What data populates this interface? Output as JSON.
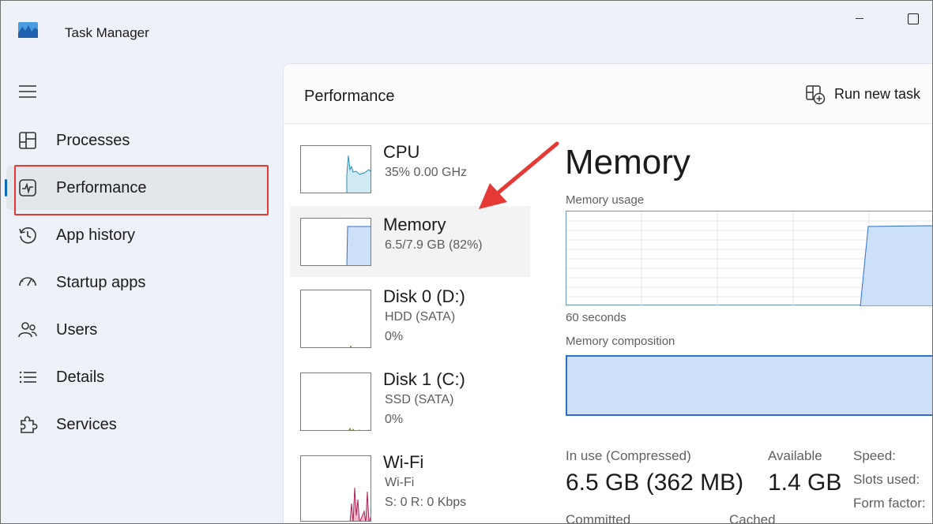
{
  "window": {
    "title": "Task Manager"
  },
  "sidebar": {
    "items": [
      {
        "label": "Processes",
        "icon": "processes-icon",
        "active": false
      },
      {
        "label": "Performance",
        "icon": "performance-icon",
        "active": true
      },
      {
        "label": "App history",
        "icon": "history-icon",
        "active": false
      },
      {
        "label": "Startup apps",
        "icon": "speedometer-icon",
        "active": false
      },
      {
        "label": "Users",
        "icon": "users-icon",
        "active": false
      },
      {
        "label": "Details",
        "icon": "list-icon",
        "active": false
      },
      {
        "label": "Services",
        "icon": "puzzle-icon",
        "active": false
      }
    ]
  },
  "header": {
    "title": "Performance",
    "run_task_label": "Run new task"
  },
  "devices": [
    {
      "name": "CPU",
      "sub1": "35%  0.00 GHz",
      "sub2": ""
    },
    {
      "name": "Memory",
      "sub1": "6.5/7.9 GB (82%)",
      "sub2": ""
    },
    {
      "name": "Disk 0 (D:)",
      "sub1": "HDD (SATA)",
      "sub2": "0%"
    },
    {
      "name": "Disk 1 (C:)",
      "sub1": "SSD (SATA)",
      "sub2": "0%"
    },
    {
      "name": "Wi-Fi",
      "sub1": "Wi-Fi",
      "sub2": "S: 0  R: 0 Kbps"
    }
  ],
  "detail": {
    "title": "Memory",
    "usage_label": "Memory usage",
    "time_label": "60 seconds",
    "composition_label": "Memory composition",
    "in_use_label": "In use (Compressed)",
    "in_use_value": "6.5 GB (362 MB)",
    "available_label": "Available",
    "available_value": "1.4 GB",
    "committed_label": "Committed",
    "cached_label": "Cached",
    "specs": [
      "Speed:",
      "Slots used:",
      "Form factor:"
    ]
  },
  "colors": {
    "accent": "#0f6cbd",
    "memory_fill": "#cde0f9",
    "memory_line": "#2f6fd2",
    "annotation": "#e53935"
  }
}
